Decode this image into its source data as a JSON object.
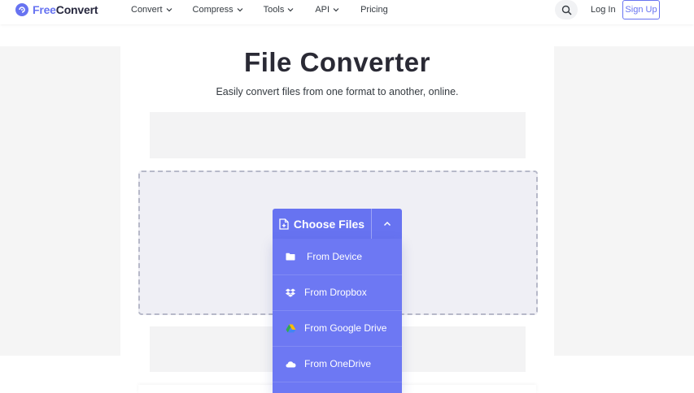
{
  "header": {
    "logo_free": "Free",
    "logo_convert": "Convert",
    "nav": [
      {
        "label": "Convert",
        "has_dropdown": true
      },
      {
        "label": "Compress",
        "has_dropdown": true
      },
      {
        "label": "Tools",
        "has_dropdown": true
      },
      {
        "label": "API",
        "has_dropdown": true
      },
      {
        "label": "Pricing",
        "has_dropdown": false
      }
    ],
    "search_icon": "search-icon",
    "login_label": "Log In",
    "signup_label": "Sign Up"
  },
  "hero": {
    "title": "File Converter",
    "subtitle": "Easily convert files from one format to another, online."
  },
  "uploader": {
    "choose_label": "Choose Files",
    "choose_icon": "file-plus-icon",
    "toggle_icon": "chevron-up-icon",
    "menu": [
      {
        "label": "From Device",
        "icon": "folder-icon"
      },
      {
        "label": "From Dropbox",
        "icon": "dropbox-icon"
      },
      {
        "label": "From Google Drive",
        "icon": "google-drive-icon"
      },
      {
        "label": "From OneDrive",
        "icon": "onedrive-icon"
      }
    ]
  },
  "colors": {
    "brand": "#6773f1",
    "dropzone_bg": "#efeff5",
    "page_gray": "#f5f5f5"
  }
}
